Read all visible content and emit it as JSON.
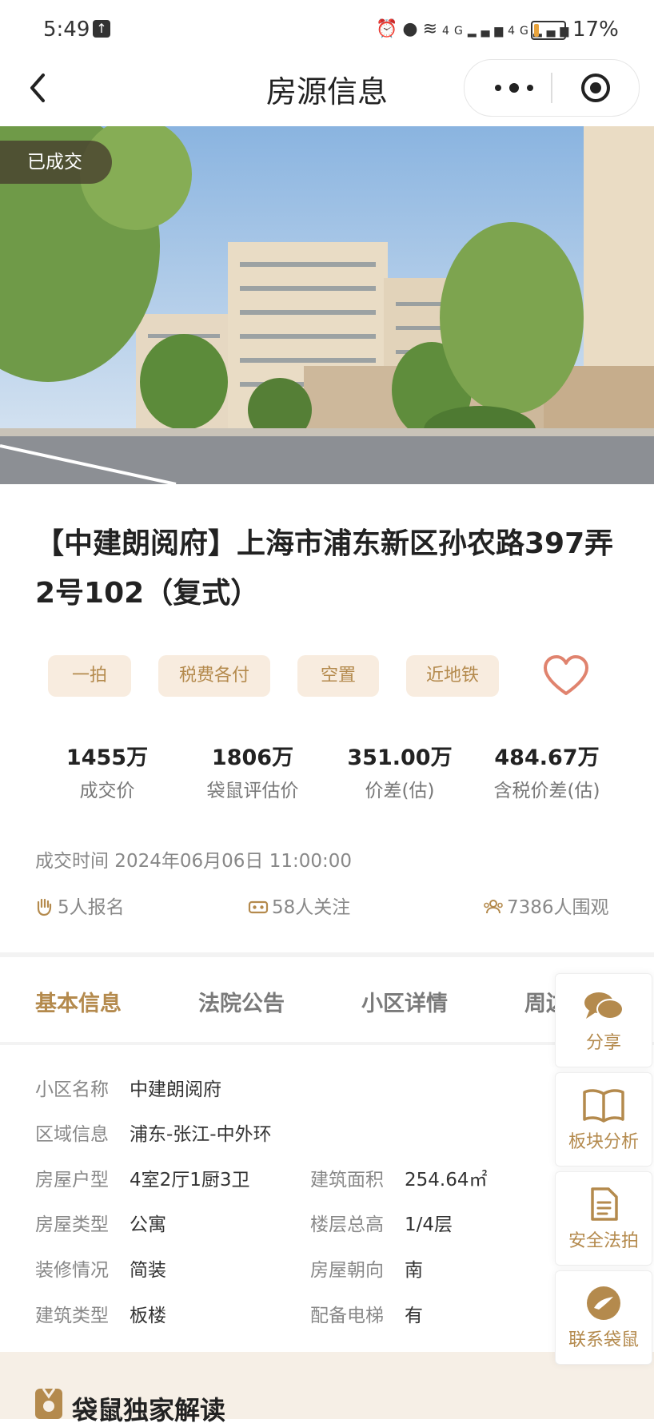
{
  "status_bar": {
    "time": "5:49",
    "battery_pct": "17%",
    "battery_level": 0.17,
    "net1": "4G",
    "net2": "4G"
  },
  "nav": {
    "title": "房源信息"
  },
  "hero": {
    "badge": "已成交"
  },
  "title": "【中建朗阅府】上海市浦东新区孙农路397弄2号102（复式）",
  "tags": [
    "一拍",
    "税费各付",
    "空置",
    "近地铁"
  ],
  "prices": [
    {
      "value": "1455万",
      "label": "成交价"
    },
    {
      "value": "1806万",
      "label": "袋鼠评估价"
    },
    {
      "value": "351.00万",
      "label": "价差(估)"
    },
    {
      "value": "484.67万",
      "label": "含税价差(估)"
    }
  ],
  "deal_time": "成交时间 2024年06月06日 11:00:00",
  "stats": {
    "signup": "5人报名",
    "follow": "58人关注",
    "watch": "7386人围观"
  },
  "tabs": [
    "基本信息",
    "法院公告",
    "小区详情",
    "周边"
  ],
  "info": {
    "community_label": "小区名称",
    "community": "中建朗阅府",
    "area_label": "区域信息",
    "area": "浦东-张江-中外环",
    "layout_label": "房屋户型",
    "layout": "4室2厅1厨3卫",
    "size_label": "建筑面积",
    "size": "254.64㎡",
    "type_label": "房屋类型",
    "type": "公寓",
    "floor_label": "楼层总高",
    "floor": "1/4层",
    "decor_label": "装修情况",
    "decor": "简装",
    "orient_label": "房屋朝向",
    "orient": "南",
    "build_label": "建筑类型",
    "build": "板楼",
    "elev_label": "配备电梯",
    "elev": "有"
  },
  "floating": {
    "share": "分享",
    "analysis": "板块分析",
    "safe": "安全法拍",
    "contact": "联系袋鼠"
  },
  "section": {
    "title": "袋鼠独家解读"
  },
  "colors": {
    "accent": "#b48a4d",
    "tag_bg": "#f8ecdf",
    "heart": "#e0836e"
  }
}
